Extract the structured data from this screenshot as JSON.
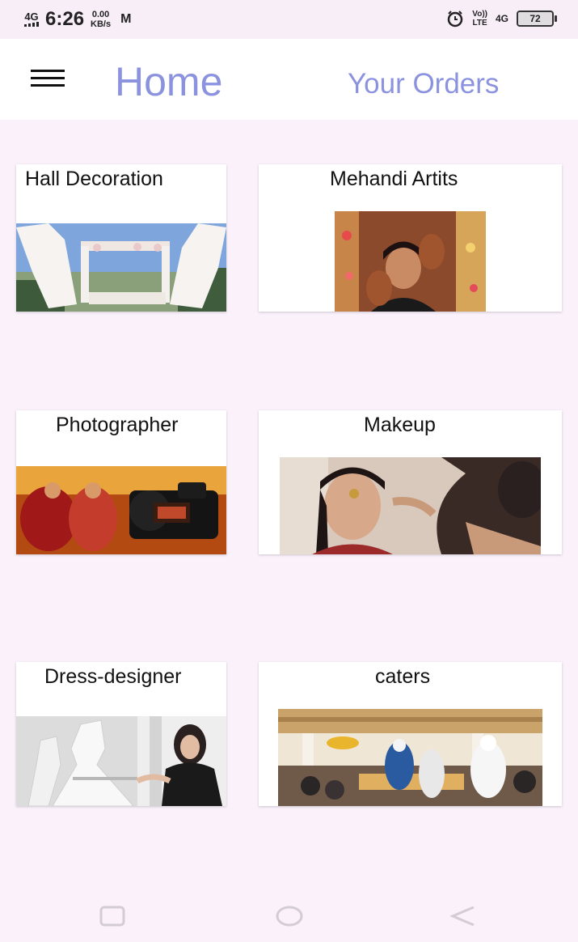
{
  "status_bar": {
    "network": "4G",
    "time": "6:26",
    "speed_value": "0.00",
    "speed_unit": "KB/s",
    "mail_icon": "gmail-icon",
    "alarm_icon": "alarm-icon",
    "volte_top": "Vo))",
    "volte_bottom": "LTE",
    "network_right": "4G",
    "battery": "72"
  },
  "app_bar": {
    "menu_icon": "hamburger-menu-icon",
    "home": "Home",
    "orders": "Your Orders"
  },
  "categories": [
    {
      "title": "Hall Decoration",
      "image": "hall-decoration-photo"
    },
    {
      "title": "Mehandi Artits",
      "image": "mehandi-artist-photo"
    },
    {
      "title": "Photographer",
      "image": "photographer-photo"
    },
    {
      "title": "Makeup",
      "image": "makeup-photo"
    },
    {
      "title": "Dress-designer",
      "image": "dress-designer-photo"
    },
    {
      "title": "caters",
      "image": "caterers-photo"
    }
  ],
  "colors": {
    "accent": "#8b93df",
    "background": "#faf1fb"
  }
}
